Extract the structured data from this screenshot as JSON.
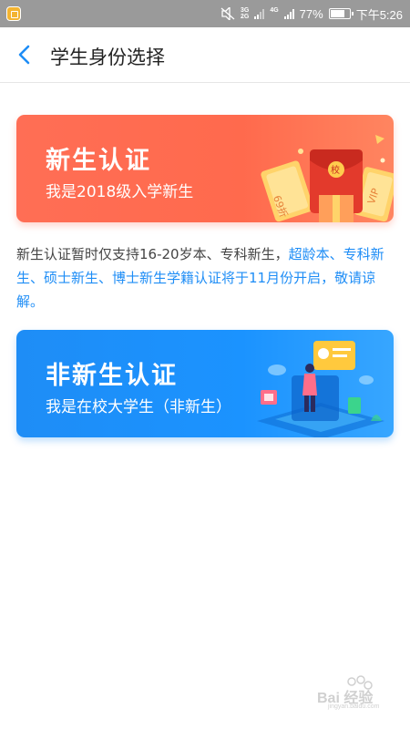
{
  "status_bar": {
    "net1_top": "3G",
    "net1_bottom": "2G",
    "net2": "4G",
    "battery_percent": "77%",
    "battery_level": 0.77,
    "time": "下午5:26"
  },
  "header": {
    "title": "学生身份选择",
    "back_icon": "chevron-left-icon"
  },
  "cards": {
    "new_student": {
      "title": "新生认证",
      "subtitle": "我是2018级入学新生",
      "art_badge": "校",
      "ticket1": "69折",
      "ticket2": "VIP"
    },
    "non_new_student": {
      "title": "非新生认证",
      "subtitle": "我是在校大学生（非新生）"
    }
  },
  "notice": {
    "plain": "新生认证暂时仅支持16-20岁本、专科新生，",
    "highlight": "超龄本、专科新生、硕士新生、博士新生学籍认证将于11月份开启，敬请谅解。"
  },
  "watermark": {
    "text": "Bai 经验",
    "sub": "jingyan.baidu.com"
  },
  "colors": {
    "accent_blue": "#1e8df6",
    "card_orange": "#ff6e55",
    "card_blue": "#1e8df6"
  }
}
